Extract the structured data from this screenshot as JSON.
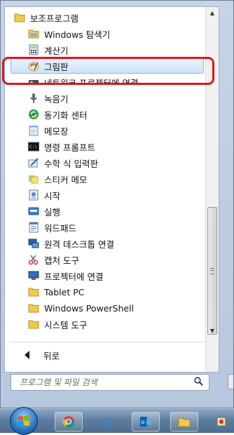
{
  "menu": {
    "items": [
      {
        "label": "보조프로그램",
        "icon": "folder-icon",
        "kind": "root"
      },
      {
        "label": "Windows 탐색기",
        "icon": "explorer-icon"
      },
      {
        "label": "계산기",
        "icon": "calculator-icon"
      },
      {
        "label": "그림판",
        "icon": "paint-icon",
        "selected": true
      },
      {
        "label": "네트워크 프로젝터에 연결",
        "icon": "network-projector-icon"
      },
      {
        "label": "녹음기",
        "icon": "microphone-icon"
      },
      {
        "label": "동기화 센터",
        "icon": "sync-center-icon"
      },
      {
        "label": "메모장",
        "icon": "notepad-icon"
      },
      {
        "label": "명령 프롬프트",
        "icon": "command-prompt-icon"
      },
      {
        "label": "수학 식 입력판",
        "icon": "math-input-icon"
      },
      {
        "label": "스티커 메모",
        "icon": "sticky-notes-icon"
      },
      {
        "label": "시작",
        "icon": "getting-started-icon"
      },
      {
        "label": "실행",
        "icon": "run-icon"
      },
      {
        "label": "워드패드",
        "icon": "wordpad-icon"
      },
      {
        "label": "원격 데스크톱 연결",
        "icon": "remote-desktop-icon"
      },
      {
        "label": "캡처 도구",
        "icon": "snipping-tool-icon"
      },
      {
        "label": "프로젝터에 연결",
        "icon": "projector-icon"
      },
      {
        "label": "Tablet PC",
        "icon": "folder-icon"
      },
      {
        "label": "Windows PowerShell",
        "icon": "folder-icon"
      },
      {
        "label": "시스템 도구",
        "icon": "folder-icon"
      }
    ],
    "back_label": "뒤로",
    "search_placeholder": "프로그램 및 파일 검색"
  },
  "taskbar": {
    "buttons": [
      "start-orb",
      "chrome-icon",
      "internet-explorer-icon",
      "outlook-icon",
      "file-explorer-icon",
      "app-icon"
    ]
  },
  "colors": {
    "highlight_ring": "#e0141c",
    "selection": "#cfe3fa"
  }
}
